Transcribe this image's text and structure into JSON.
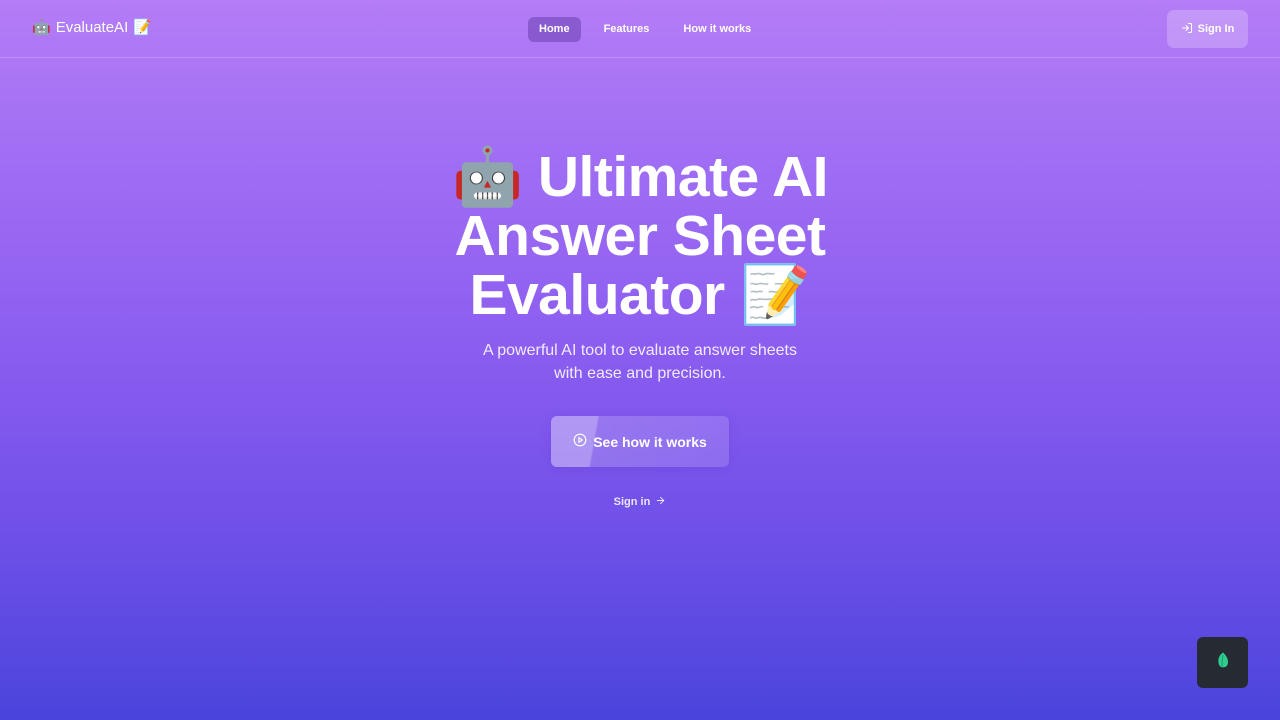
{
  "brand": {
    "icon_left": "🤖",
    "name": "EvaluateAI",
    "icon_right": "📝"
  },
  "nav": {
    "items": [
      {
        "label": "Home",
        "active": true
      },
      {
        "label": "Features",
        "active": false
      },
      {
        "label": "How it works",
        "active": false
      }
    ]
  },
  "header": {
    "signin_label": "Sign In",
    "signin_icon": "login-icon"
  },
  "hero": {
    "title_line1": "🤖 Ultimate AI",
    "title_line2": "Answer Sheet",
    "title_line3": "Evaluator 📝",
    "subtitle_line1": "A powerful AI tool to evaluate answer sheets",
    "subtitle_line2": "with ease and precision.",
    "cta_label": "See how it works",
    "cta_icon": "play-circle-icon",
    "signin_link_label": "Sign in",
    "signin_link_icon": "arrow-right-icon"
  },
  "widget": {
    "icon": "leaf-icon",
    "color": "#2ecc8f"
  },
  "colors": {
    "gradient_top": "#b47cf6",
    "gradient_bottom": "#4a44dc",
    "widget_bg": "#262a33"
  }
}
